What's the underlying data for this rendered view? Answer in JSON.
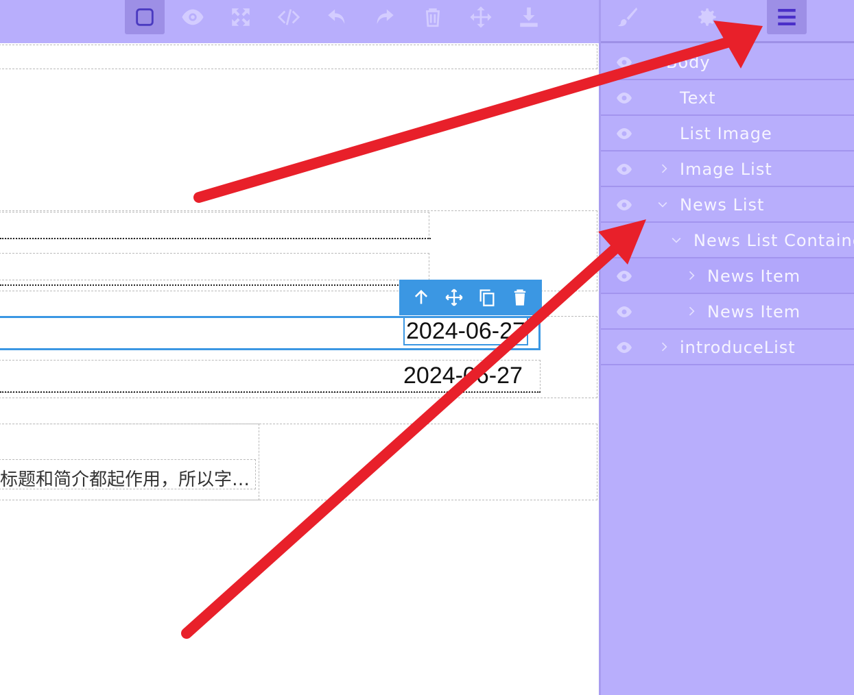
{
  "toolbar": {
    "buttons": [
      {
        "name": "square-icon",
        "active": true
      },
      {
        "name": "eye-icon"
      },
      {
        "name": "fullscreen-icon"
      },
      {
        "name": "code-icon"
      },
      {
        "name": "undo-icon"
      },
      {
        "name": "redo-icon"
      },
      {
        "name": "trash-icon"
      },
      {
        "name": "move-icon"
      },
      {
        "name": "download-icon"
      }
    ]
  },
  "panel": {
    "header_buttons": [
      {
        "name": "brush-icon"
      },
      {
        "name": "gear-icon"
      },
      {
        "name": "layers-menu-icon",
        "active": true
      }
    ],
    "layers": [
      {
        "label": "Body",
        "caret": "none"
      },
      {
        "label": "Text",
        "caret": "none"
      },
      {
        "label": "List Image",
        "caret": "none"
      },
      {
        "label": "Image List",
        "caret": "right"
      },
      {
        "label": "News List",
        "caret": "down"
      },
      {
        "label": "News List Containe",
        "caret": "down"
      },
      {
        "label": "News Item",
        "caret": "right"
      },
      {
        "label": "News Item",
        "caret": "right"
      },
      {
        "label": "introduceList",
        "caret": "right"
      }
    ]
  },
  "canvas": {
    "date_selected": "2024-06-27",
    "date_second": "2024-06-27",
    "cn_snippet": "标题和简介都起作用，所以字…"
  },
  "selection_toolbar": [
    "arrow-up-icon",
    "move-icon",
    "copy-icon",
    "delete-icon"
  ],
  "colors": {
    "toolbar_bg": "#b8aefc",
    "selection": "#3b97e3",
    "arrow": "#e8202a"
  }
}
